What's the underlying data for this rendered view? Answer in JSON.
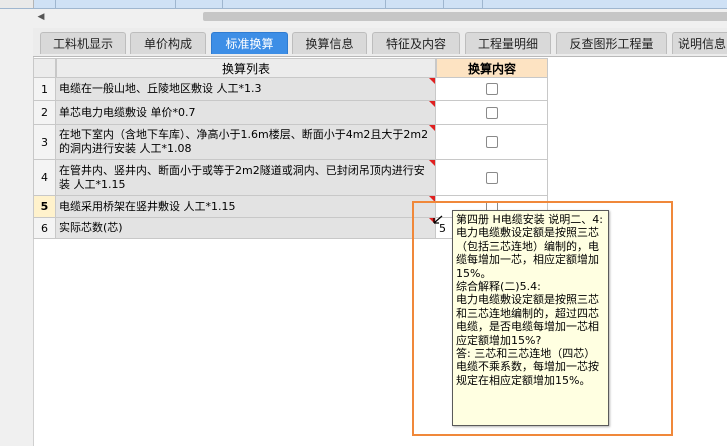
{
  "tabs": [
    {
      "label": "工料机显示",
      "active": false
    },
    {
      "label": "单价构成",
      "active": false
    },
    {
      "label": "标准换算",
      "active": true
    },
    {
      "label": "换算信息",
      "active": false
    },
    {
      "label": "特征及内容",
      "active": false
    },
    {
      "label": "工程量明细",
      "active": false
    },
    {
      "label": "反查图形工程量",
      "active": false
    },
    {
      "label": "说明信息",
      "active": false
    }
  ],
  "table": {
    "headers": {
      "list": "换算列表",
      "content": "换算内容"
    },
    "rows": [
      {
        "num": "1",
        "text": "电缆在一般山地、丘陵地区敷设 人工*1.3",
        "type": "checkbox"
      },
      {
        "num": "2",
        "text": "单芯电力电缆敷设 单价*0.7",
        "type": "checkbox"
      },
      {
        "num": "3",
        "text": "在地下室内（含地下车库）、净高小于1.6m楼层、断面小于4m2且大于2m2的洞内进行安装 人工*1.08",
        "type": "checkbox"
      },
      {
        "num": "4",
        "text": "在管井内、竖井内、断面小于或等于2m2隧道或洞内、已封闭吊顶内进行安装 人工*1.15",
        "type": "checkbox"
      },
      {
        "num": "5",
        "text": "电缆采用桥架在竖井敷设 人工*1.15",
        "type": "checkbox",
        "current": true
      },
      {
        "num": "6",
        "text": "实际芯数(芯)",
        "type": "value",
        "value": "5"
      }
    ]
  },
  "tooltip": {
    "lines": [
      "第四册 H电缆安装 说明二、4:",
      "电力电缆敷设定额是按照三芯（包括三芯连地）编制的，电缆每增加一芯，相应定额增加15%。",
      "综合解释(二)5.4:",
      "电力电缆敷设定额是按照三芯和三芯连地编制的，超过四芯电缆，是否电缆每增加一芯相应定额增加15%?",
      "答: 三芯和三芯连地（四芯）电缆不乘系数，每增加一芯按规定在相应定额增加15%。"
    ]
  },
  "colors": {
    "active_tab": "#3d8ee6",
    "header_content": "#fde3c2",
    "tooltip_bg": "#ffffe1",
    "highlight": "#f0883a",
    "marker": "#e02020"
  }
}
